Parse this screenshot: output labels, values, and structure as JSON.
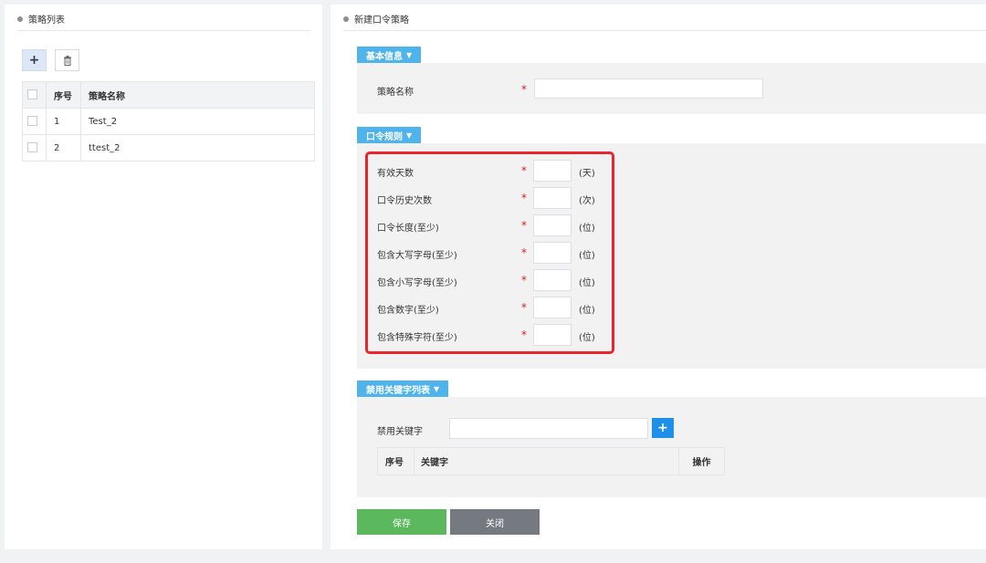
{
  "left": {
    "title": "策略列表",
    "table": {
      "headers": [
        "序号",
        "策略名称"
      ],
      "rows": [
        {
          "no": "1",
          "name": "Test_2"
        },
        {
          "no": "2",
          "name": "ttest_2"
        }
      ]
    },
    "add_glyph": "+",
    "delete_glyph": "🗑"
  },
  "right": {
    "title": "新建口令策略",
    "basic": {
      "tag": "基本信息",
      "name_label": "策略名称",
      "required": "*",
      "name_value": ""
    },
    "rules": {
      "tag": "口令规则",
      "fields": [
        {
          "label": "有效天数",
          "unit": "(天)",
          "value": ""
        },
        {
          "label": "口令历史次数",
          "unit": "(次)",
          "value": ""
        },
        {
          "label": "口令长度(至少)",
          "unit": "(位)",
          "value": ""
        },
        {
          "label": "包含大写字母(至少)",
          "unit": "(位)",
          "value": ""
        },
        {
          "label": "包含小写字母(至少)",
          "unit": "(位)",
          "value": ""
        },
        {
          "label": "包含数字(至少)",
          "unit": "(位)",
          "value": ""
        },
        {
          "label": "包含特殊字符(至少)",
          "unit": "(位)",
          "value": ""
        }
      ]
    },
    "keywords": {
      "tag": "禁用关键字列表",
      "label": "禁用关键字",
      "value": "",
      "add_glyph": "+",
      "headers": {
        "no": "序号",
        "keyword": "关键字",
        "op": "操作"
      }
    },
    "buttons": {
      "save": "保存",
      "close": "关闭"
    }
  },
  "colors": {
    "tag_blue": "#4fb3ec",
    "plus_blue": "#1e90e8",
    "save_green": "#5cb85c",
    "close_gray": "#757a80",
    "highlight_red": "#e8262b",
    "required_red": "#e02020"
  }
}
